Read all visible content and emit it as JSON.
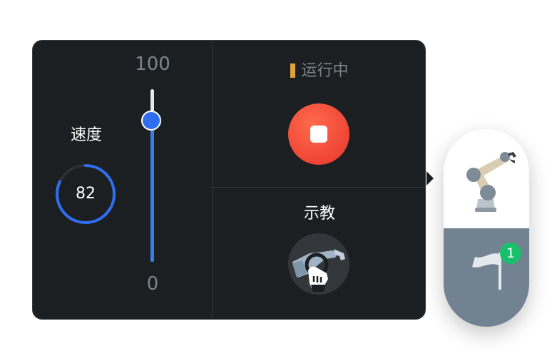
{
  "speed": {
    "label": "速度",
    "value": "82",
    "percent": 82,
    "gauge_color": "#2f6ef0"
  },
  "slider": {
    "max_label": "100",
    "min_label": "0",
    "value": 82,
    "fill_color": "#3b7de8"
  },
  "status": {
    "text": "运行中",
    "indicator_color": "#e0a23a"
  },
  "stop": {
    "icon": "stop-icon",
    "color": "#e8352c"
  },
  "teach": {
    "label": "示教",
    "icon": "teach-hand-robot-icon"
  },
  "side": {
    "robot_icon": "robot-arm-icon",
    "flag_icon": "flag-icon",
    "badge_count": "1",
    "badge_color": "#19c06b"
  }
}
